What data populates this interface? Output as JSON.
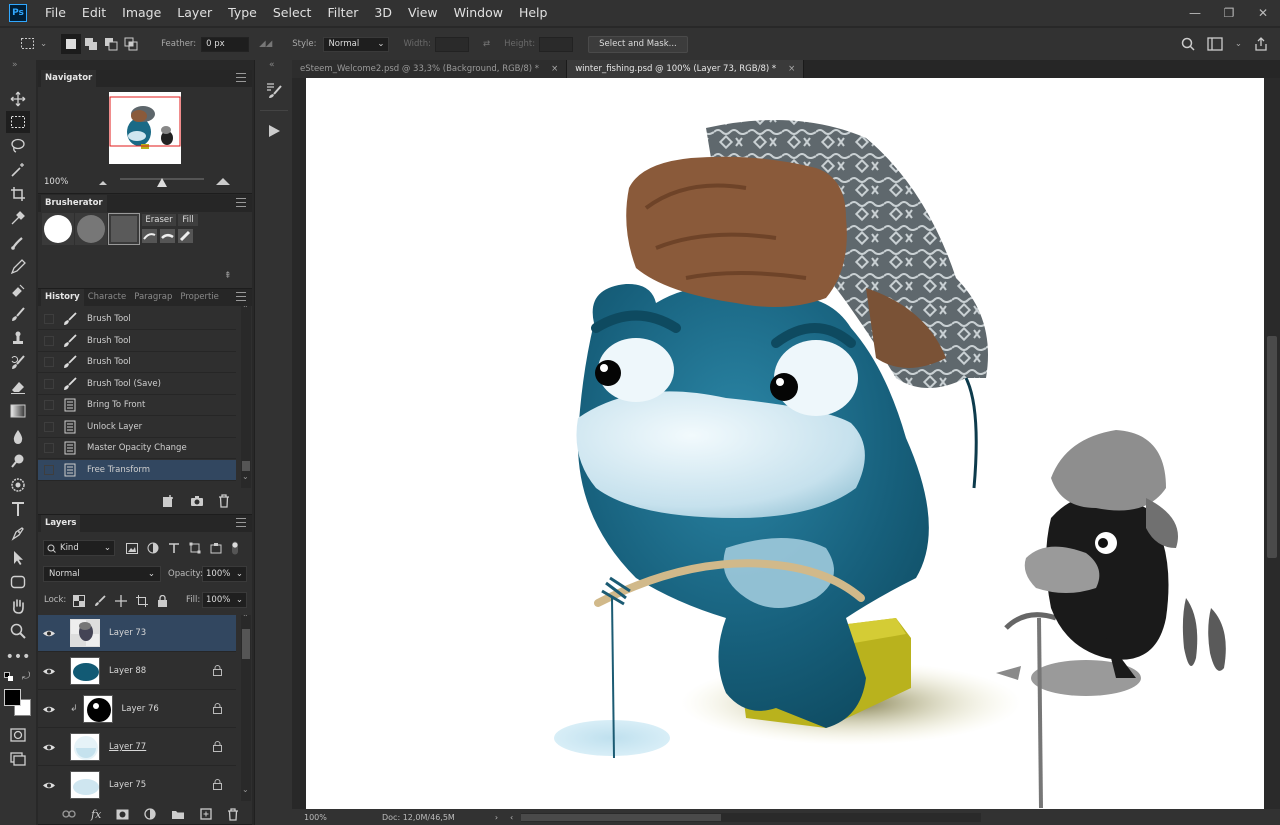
{
  "app": {
    "logo": "Ps"
  },
  "menu": [
    "File",
    "Edit",
    "Image",
    "Layer",
    "Type",
    "Select",
    "Filter",
    "3D",
    "View",
    "Window",
    "Help"
  ],
  "window_controls": {
    "minimize": "—",
    "restore": "❐",
    "close": "✕"
  },
  "options": {
    "feather_label": "Feather:",
    "feather_value": "0 px",
    "style_label": "Style:",
    "style_value": "Normal",
    "width_label": "Width:",
    "height_label": "Height:",
    "select_mask_label": "Select and Mask..."
  },
  "tools": [
    "move-tool",
    "marquee-tool",
    "lasso-tool",
    "magic-wand-tool",
    "crop-tool",
    "eyedropper-tool",
    "healing-brush-tool",
    "brush-tool",
    "clone-stamp-tool",
    "history-brush-tool",
    "eraser-tool",
    "gradient-tool",
    "blur-tool",
    "dodge-tool",
    "pen-tool",
    "type-tool",
    "path-selection-tool",
    "rectangle-tool",
    "hand-tool",
    "zoom-tool",
    "more-tools"
  ],
  "navigator": {
    "title": "Navigator",
    "zoom": "100%"
  },
  "brusherator": {
    "title": "Brusherator",
    "eraser_label": "Eraser",
    "fill_label": "Fill"
  },
  "history": {
    "tabs": [
      "History",
      "Characte",
      "Paragrap",
      "Propertie"
    ],
    "items": [
      "Brush Tool",
      "Brush Tool",
      "Brush Tool",
      "Brush Tool (Save)",
      "Bring To Front",
      "Unlock Layer",
      "Master Opacity Change",
      "Free Transform"
    ],
    "icons": [
      "brush",
      "brush",
      "brush",
      "brush",
      "doc",
      "doc",
      "doc",
      "doc"
    ],
    "selected_index": 7
  },
  "layers": {
    "title": "Layers",
    "kind_label": "Kind",
    "blend_mode": "Normal",
    "opacity_label": "Opacity:",
    "opacity_value": "100%",
    "lock_label": "Lock:",
    "fill_label": "Fill:",
    "fill_value": "100%",
    "items": [
      {
        "name": "Layer 73",
        "selected": true
      },
      {
        "name": "Layer 88",
        "locked": true
      },
      {
        "name": "Layer 76",
        "locked": true
      },
      {
        "name": "Layer 77",
        "locked": true
      },
      {
        "name": "Layer 75",
        "locked": true
      }
    ]
  },
  "documents": {
    "tabs": [
      {
        "label": "eSteem_Welcome2.psd @ 33,3% (Background, RGB/8) *",
        "active": false
      },
      {
        "label": "winter_fishing.psd @ 100% (Layer 73, RGB/8) *",
        "active": true
      }
    ]
  },
  "status": {
    "zoom": "100%",
    "doc": "Doc: 12,0M/46,5M"
  },
  "colors": {
    "accent": "#31a8ff",
    "whale": "#1a6a86",
    "hat_fur": "#8a5a3a",
    "hat_knit": "#5d666b",
    "cushion": "#b9b21d"
  }
}
